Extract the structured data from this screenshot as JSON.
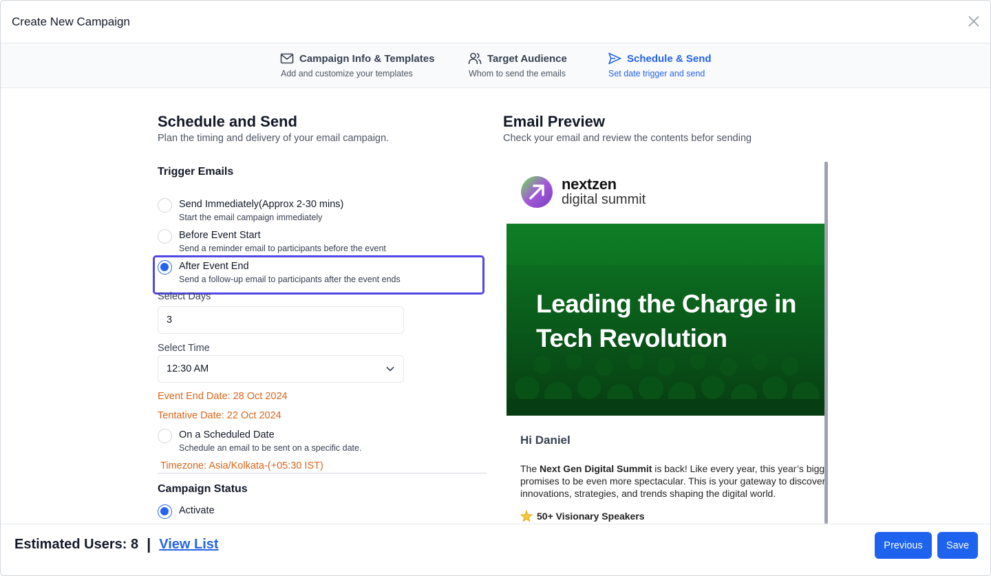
{
  "modal": {
    "title": "Create New Campaign"
  },
  "steps": [
    {
      "title": "Campaign Info & Templates",
      "subtitle": "Add and customize your templates"
    },
    {
      "title": "Target Audience",
      "subtitle": "Whom to send the emails"
    },
    {
      "title": "Schedule & Send",
      "subtitle": "Set date trigger and send"
    }
  ],
  "schedule": {
    "title": "Schedule and Send",
    "subtitle": "Plan the timing and delivery of your email campaign.",
    "trigger_title": "Trigger Emails",
    "options": [
      {
        "label": "Send Immediately(Approx 2-30 mins)",
        "desc": "Start the email campaign immediately"
      },
      {
        "label": "Before Event Start",
        "desc": "Send a reminder email to participants before the event"
      },
      {
        "label": "After Event End",
        "desc": "Send a follow-up email to participants after the event ends"
      },
      {
        "label": "On a Scheduled Date",
        "desc": "Schedule an email to be sent on a specific date."
      }
    ],
    "days_label": "Select Days",
    "days_value": "3",
    "time_label": "Select Time",
    "time_value": "12:30 AM",
    "event_end": "Event End Date: 28 Oct 2024",
    "tentative": "Tentative Date: 22 Oct 2024",
    "timezone": "Timezone: Asia/Kolkata-(+05:30 IST)",
    "status_title": "Campaign Status",
    "status_option": "Activate"
  },
  "preview": {
    "title": "Email Preview",
    "subtitle": "Check your email and review the contents befor sending",
    "logo_line1": "nextzen",
    "logo_line2": "digital summit",
    "banner_line1": "Leading the Charge in",
    "banner_line2": "Tech Revolution",
    "greeting": "Hi Daniel",
    "body_pre": "The ",
    "body_bold": "Next Gen Digital Summit",
    "body_post": " is back! Like every year, this year’s bigg",
    "body_line2": "promises to be even more spectacular. This is your gateway to discover",
    "body_line3": "innovations, strategies, and trends shaping the digital world.",
    "feature": "50+ Visionary Speakers"
  },
  "footer": {
    "est_label": "Estimated Users: 8",
    "separator": "|",
    "view_list": "View List",
    "previous": "Previous",
    "save": "Save"
  },
  "colors": {
    "primary": "#1d63ed",
    "accent": "#4f46e5",
    "warning": "#d9651b",
    "banner": "#0b6b1e"
  },
  "icons": {
    "close": "close-icon",
    "step1": "mail-icon",
    "step2": "users-icon",
    "step3": "send-icon",
    "select": "chevron-down-icon",
    "feature": "star-icon"
  }
}
